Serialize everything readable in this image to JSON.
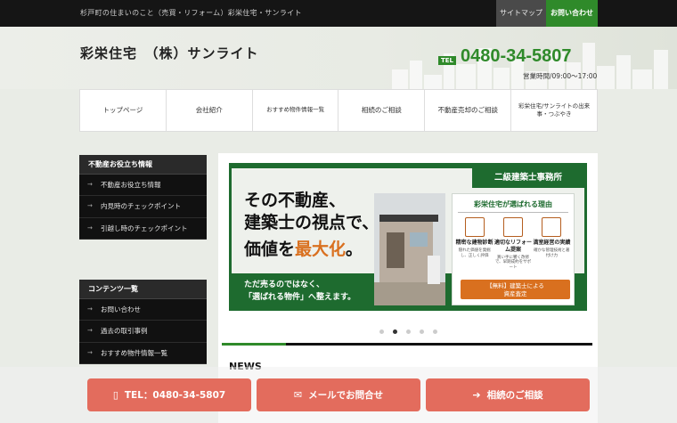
{
  "topbar": {
    "tagline": "杉戸町の住まいのこと（売買・リフォーム）彩栄住宅・サンライト",
    "sitemap": "サイトマップ",
    "contact": "お問い合わせ"
  },
  "header": {
    "logo": "彩栄住宅　（株）サンライト",
    "tel_badge": "TEL",
    "tel": "0480-34-5807",
    "hours": "営業時間/09:00～17:00"
  },
  "nav": [
    {
      "label": "トップページ"
    },
    {
      "label": "会社紹介"
    },
    {
      "label": "おすすめ物件情報一覧"
    },
    {
      "label": "相続のご相談"
    },
    {
      "label": "不動産売却のご相談"
    },
    {
      "label": "彩栄住宅/サンライトの出来事・つぶやき"
    }
  ],
  "sidebar": {
    "box1": {
      "title": "不動産お役立ち情報",
      "items": [
        "不動産お役立ち情報",
        "内見時のチェックポイント",
        "引越し時のチェックポイント"
      ]
    },
    "box2": {
      "title": "コンテンツ一覧",
      "items": [
        "お問い合わせ",
        "過去の取引事例",
        "おすすめ物件情報一覧"
      ]
    }
  },
  "slider": {
    "office": "二級建築士事務所",
    "line1": "その不動産、",
    "line2": "建築士の視点で、",
    "line3a": "価値を",
    "line3b": "最大化",
    "line3c": "。",
    "sub1": "ただ売るのではなく、",
    "sub2": "「選ばれる物件」へ整えます。",
    "reasons_title": "彩栄住宅が選ばれる理由",
    "reasons": [
      {
        "label": "精密な建物診断",
        "desc": "隠れた価値を発掘し、正しく評価"
      },
      {
        "label": "適切なリフォーム提案",
        "desc": "買い手に響く改修で、早期成約をサポート"
      },
      {
        "label": "満室経営の実績",
        "desc": "確かな管理技術と著付け力"
      }
    ],
    "button1": "【無料】建築士による",
    "button2": "資産査定",
    "active_index": 1,
    "total": 5
  },
  "news": {
    "title": "NEWS"
  },
  "cta": {
    "tel": "TEL：0480-34-5807",
    "mail": "メールでお問合せ",
    "inherit": "相続のご相談"
  },
  "colors": {
    "brand_green": "#2f8a2a",
    "dark_green": "#1e6b2f",
    "accent_orange": "#d9701f",
    "cta_red": "#e36c5d"
  }
}
